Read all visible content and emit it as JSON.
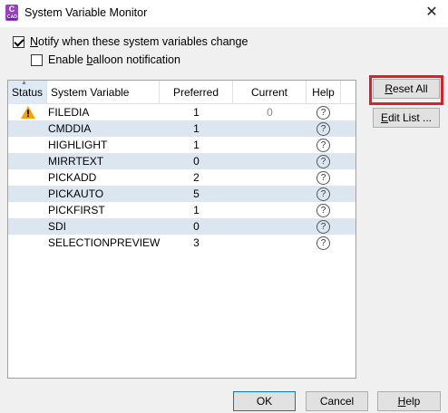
{
  "window": {
    "title": "System Variable Monitor",
    "app_icon_letter": "C",
    "app_icon_sub": "CAD"
  },
  "options": {
    "notify_label_u": "N",
    "notify_label_rest": "otify when these system variables change",
    "notify_checked": true,
    "balloon_label_pre": "Enable ",
    "balloon_label_u": "b",
    "balloon_label_rest": "alloon notification",
    "balloon_checked": false
  },
  "table": {
    "headers": {
      "status": "Status",
      "variable": "System Variable",
      "preferred": "Preferred",
      "current": "Current",
      "help": "Help"
    },
    "rows": [
      {
        "status": "warning",
        "name": "FILEDIA",
        "preferred": "1",
        "current": "0"
      },
      {
        "status": "",
        "name": "CMDDIA",
        "preferred": "1",
        "current": ""
      },
      {
        "status": "",
        "name": "HIGHLIGHT",
        "preferred": "1",
        "current": ""
      },
      {
        "status": "",
        "name": "MIRRTEXT",
        "preferred": "0",
        "current": ""
      },
      {
        "status": "",
        "name": "PICKADD",
        "preferred": "2",
        "current": ""
      },
      {
        "status": "",
        "name": "PICKAUTO",
        "preferred": "5",
        "current": ""
      },
      {
        "status": "",
        "name": "PICKFIRST",
        "preferred": "1",
        "current": ""
      },
      {
        "status": "",
        "name": "SDI",
        "preferred": "0",
        "current": ""
      },
      {
        "status": "",
        "name": "SELECTIONPREVIEW",
        "preferred": "3",
        "current": ""
      }
    ]
  },
  "buttons": {
    "reset_u": "R",
    "reset_rest": "eset All",
    "edit_u": "E",
    "edit_rest": "dit List ...",
    "ok": "OK",
    "cancel": "Cancel",
    "help_u": "H",
    "help_rest": "elp"
  },
  "colors": {
    "highlight": "#e01e2a",
    "row_alt": "#dce6f1",
    "warning": "#f0a30a"
  }
}
